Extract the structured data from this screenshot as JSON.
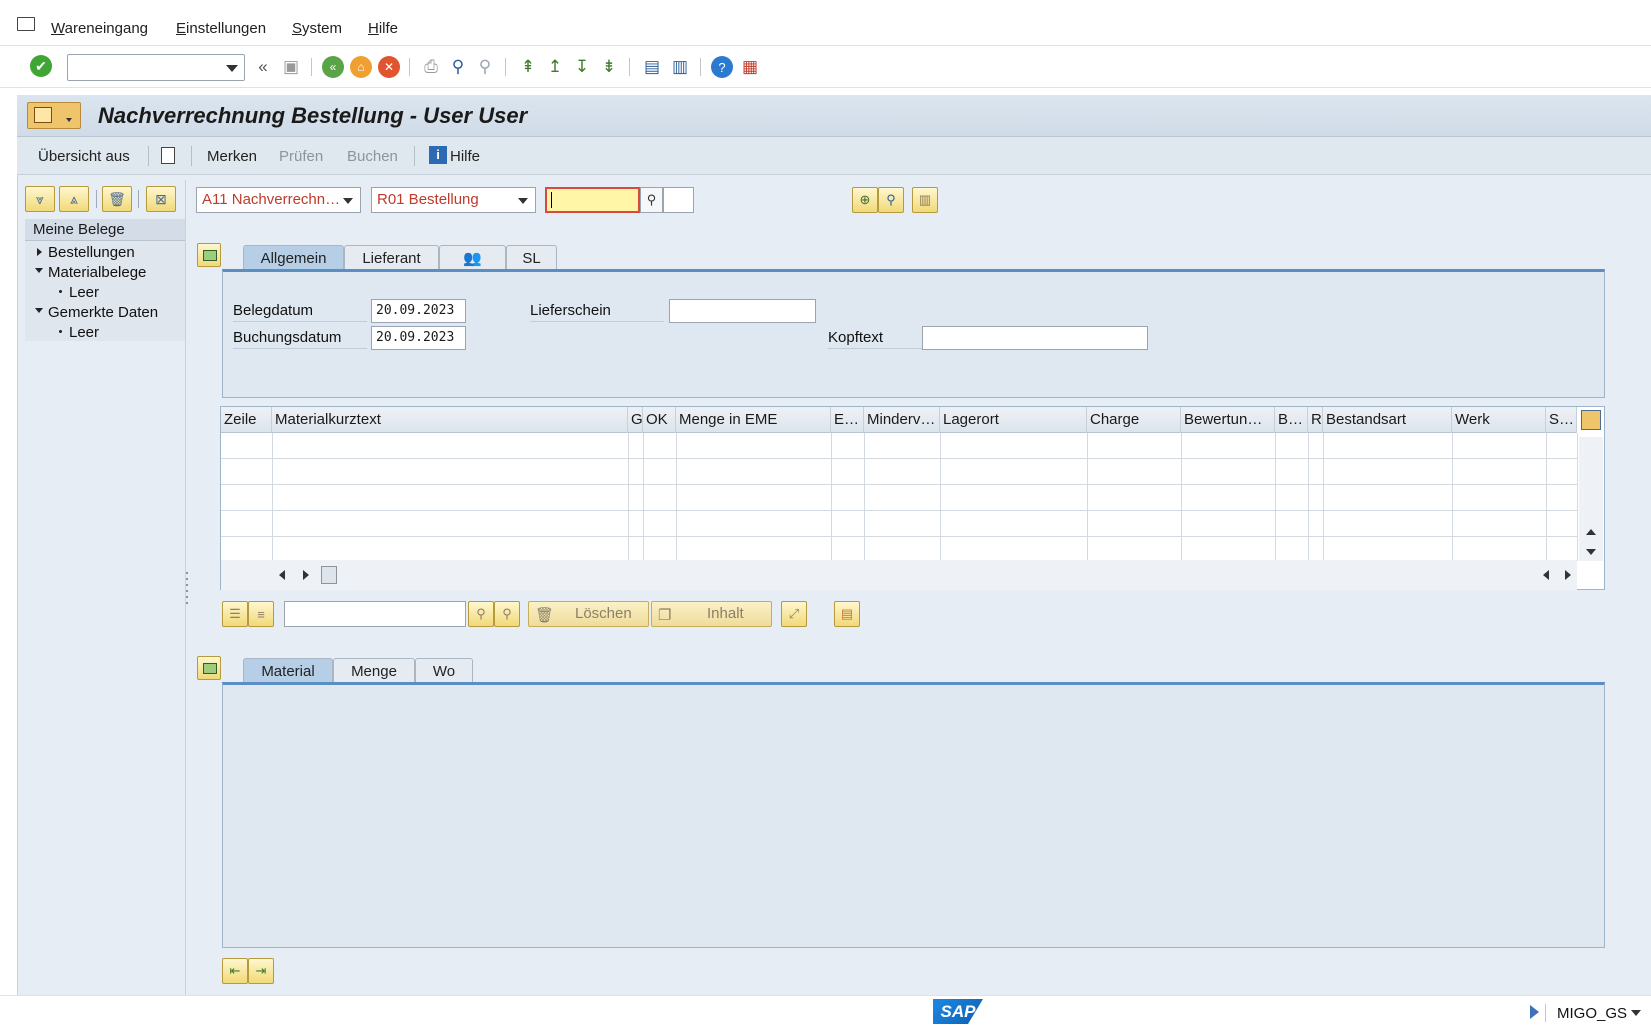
{
  "menu": {
    "items": [
      "Wareneingang",
      "Einstellungen",
      "System",
      "Hilfe"
    ]
  },
  "toolbar": {
    "command_value": "",
    "icons": [
      "enter-icon",
      "back-arrows-icon",
      "save-icon",
      "back-icon",
      "exit-icon",
      "cancel-icon",
      "print-icon",
      "find-icon",
      "find-next-icon",
      "first-page-icon",
      "prev-page-icon",
      "next-page-icon",
      "last-page-icon",
      "create-session-icon",
      "shortcut-icon",
      "help-icon",
      "customize-icon"
    ]
  },
  "title": "Nachverrechnung Bestellung - User User",
  "appbar": {
    "overview": "Übersicht aus",
    "merken": "Merken",
    "pruefen": "Prüfen",
    "buchen": "Buchen",
    "hilfe": "Hilfe"
  },
  "tree": {
    "header": "Meine Belege",
    "items": [
      {
        "label": "Bestellungen"
      },
      {
        "label": "Materialbelege"
      },
      {
        "label": "Leer"
      },
      {
        "label": "Gemerkte Daten"
      },
      {
        "label": "Leer"
      }
    ]
  },
  "header": {
    "action": "A11 Nachverrechn…",
    "reference": "R01 Bestellung",
    "po_number": ""
  },
  "top_tabs": [
    "Allgemein",
    "Lieferant",
    "",
    "SL"
  ],
  "general": {
    "belegdatum_label": "Belegdatum",
    "belegdatum_value": "20.09.2023",
    "buchungsdatum_label": "Buchungsdatum",
    "buchungsdatum_value": "20.09.2023",
    "lieferschein_label": "Lieferschein",
    "lieferschein_value": "",
    "kopftext_label": "Kopftext",
    "kopftext_value": ""
  },
  "grid": {
    "columns": [
      "Zeile",
      "Materialkurztext",
      "G",
      "OK",
      "Menge in EME",
      "E…",
      "Minderv…",
      "Lagerort",
      "Charge",
      "Bewertun…",
      "B…",
      "R",
      "Bestandsart",
      "Werk",
      "S…"
    ],
    "rows": []
  },
  "grid_toolbar": {
    "search_value": "",
    "loeschen": "Löschen",
    "inhalt": "Inhalt"
  },
  "bottom_tabs": [
    "Material",
    "Menge",
    "Wo"
  ],
  "status": {
    "transaction": "MIGO_GS",
    "logo": "SAP"
  },
  "colors": {
    "accent_blue": "#5b8fc4",
    "title_orange": "#f0c46a",
    "required_red": "#d94a3a",
    "combo_text_red": "#c0392b"
  }
}
